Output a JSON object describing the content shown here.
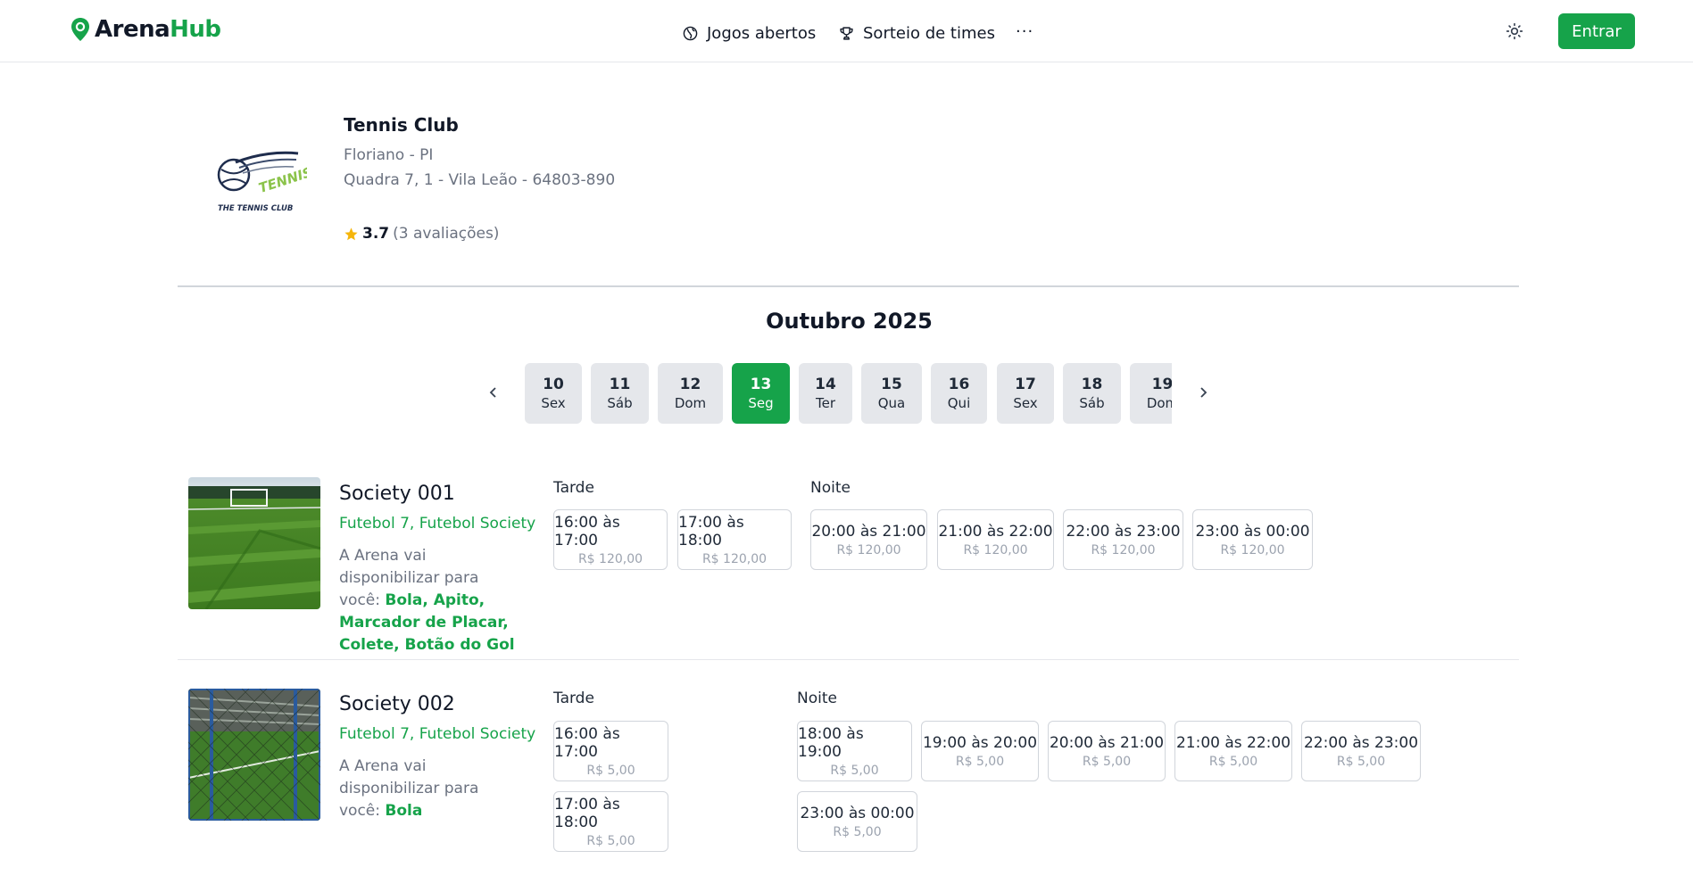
{
  "header": {
    "brand_part1": "Arena",
    "brand_part2": "Hub",
    "nav": [
      {
        "label": "Jogos abertos",
        "icon": "globe-icon"
      },
      {
        "label": "Sorteio de times",
        "icon": "trophy-icon"
      }
    ],
    "more_label": "···",
    "theme_icon": "sun-icon",
    "login_label": "Entrar",
    "accent_color": "#16a34a"
  },
  "venue": {
    "name": "Tennis Club",
    "city": "Floriano - PI",
    "address": "Quadra 7, 1 - Vila Leão - 64803-890",
    "rating": "3.7",
    "reviews": "(3 avaliações)",
    "logo_word": "TENNIS",
    "logo_caption": "THE TENNIS CLUB"
  },
  "calendar": {
    "month": "Outubro 2025",
    "days": [
      {
        "num": "10",
        "wd": "Sex",
        "active": false
      },
      {
        "num": "11",
        "wd": "Sáb",
        "active": false
      },
      {
        "num": "12",
        "wd": "Dom",
        "active": false
      },
      {
        "num": "13",
        "wd": "Seg",
        "active": true
      },
      {
        "num": "14",
        "wd": "Ter",
        "active": false
      },
      {
        "num": "15",
        "wd": "Qua",
        "active": false
      },
      {
        "num": "16",
        "wd": "Qui",
        "active": false
      },
      {
        "num": "17",
        "wd": "Sex",
        "active": false
      },
      {
        "num": "18",
        "wd": "Sáb",
        "active": false
      },
      {
        "num": "19",
        "wd": "Dom",
        "active": false
      }
    ]
  },
  "courts": [
    {
      "name": "Society 001",
      "sports": "Futebol 7, Futebol Society",
      "provide_prefix": "A Arena vai disponibilizar para você: ",
      "provide_items": "Bola, Apito, Marcador de Placar, Colete, Botão do Gol",
      "tarde_label": "Tarde",
      "noite_label": "Noite",
      "tarde": [
        {
          "time": "16:00 às 17:00",
          "price": "R$ 120,00"
        },
        {
          "time": "17:00 às 18:00",
          "price": "R$ 120,00"
        }
      ],
      "noite": [
        {
          "time": "20:00 às 21:00",
          "price": "R$ 120,00"
        },
        {
          "time": "21:00 às 22:00",
          "price": "R$ 120,00"
        },
        {
          "time": "22:00 às 23:00",
          "price": "R$ 120,00"
        },
        {
          "time": "23:00 às 00:00",
          "price": "R$ 120,00"
        }
      ]
    },
    {
      "name": "Society 002",
      "sports": "Futebol 7, Futebol Society",
      "provide_prefix": "A Arena vai disponibilizar para você: ",
      "provide_items": "Bola",
      "tarde_label": "Tarde",
      "noite_label": "Noite",
      "tarde": [
        {
          "time": "16:00 às 17:00",
          "price": "R$ 5,00"
        },
        {
          "time": "17:00 às 18:00",
          "price": "R$ 5,00"
        }
      ],
      "noite": [
        {
          "time": "18:00 às 19:00",
          "price": "R$ 5,00"
        },
        {
          "time": "19:00 às 20:00",
          "price": "R$ 5,00"
        },
        {
          "time": "20:00 às 21:00",
          "price": "R$ 5,00"
        },
        {
          "time": "21:00 às 22:00",
          "price": "R$ 5,00"
        },
        {
          "time": "22:00 às 23:00",
          "price": "R$ 5,00"
        },
        {
          "time": "23:00 às 00:00",
          "price": "R$ 5,00"
        }
      ]
    }
  ]
}
